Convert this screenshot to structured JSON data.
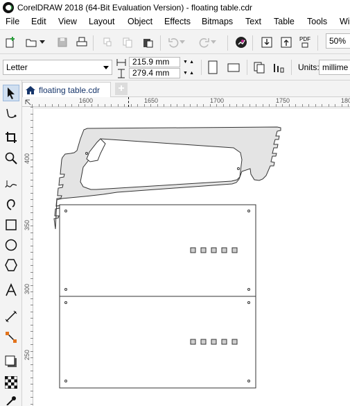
{
  "window": {
    "title": "CorelDRAW 2018 (64-Bit Evaluation Version) - floating table.cdr"
  },
  "menu": [
    {
      "label": "File",
      "name": "menu-file"
    },
    {
      "label": "Edit",
      "name": "menu-edit"
    },
    {
      "label": "View",
      "name": "menu-view"
    },
    {
      "label": "Layout",
      "name": "menu-layout"
    },
    {
      "label": "Object",
      "name": "menu-object"
    },
    {
      "label": "Effects",
      "name": "menu-effects"
    },
    {
      "label": "Bitmaps",
      "name": "menu-bitmaps"
    },
    {
      "label": "Text",
      "name": "menu-text"
    },
    {
      "label": "Table",
      "name": "menu-table"
    },
    {
      "label": "Tools",
      "name": "menu-tools"
    },
    {
      "label": "Wi",
      "name": "menu-window"
    }
  ],
  "toolbar": {
    "zoom": "50%",
    "pdf_label": "PDF"
  },
  "property_bar": {
    "page_size": "Letter",
    "width": "215.9 mm",
    "height": "279.4 mm",
    "units_label": "Units:",
    "units_value": "millime"
  },
  "tabs": {
    "document": "floating table.cdr",
    "new_tab": "+"
  },
  "ruler": {
    "h_labels": [
      "1600",
      "1650",
      "1700",
      "1750",
      "180"
    ],
    "v_labels": [
      "400",
      "350",
      "300",
      "250"
    ]
  },
  "colors": {
    "toolbar_bg": "#f3f3f3",
    "shape_fill": "#e4e4e4",
    "shape_stroke": "#333333",
    "accent": "#17366b"
  },
  "icons": {
    "tools": [
      "pick-tool-icon",
      "shape-tool-icon",
      "crop-tool-icon",
      "zoom-tool-icon",
      "freehand-tool-icon",
      "artistic-media-icon",
      "rectangle-tool-icon",
      "ellipse-tool-icon",
      "polygon-tool-icon",
      "text-tool-icon",
      "parallel-dimension-icon",
      "connector-tool-icon",
      "drop-shadow-icon",
      "transparency-icon",
      "eyedropper-icon"
    ]
  }
}
